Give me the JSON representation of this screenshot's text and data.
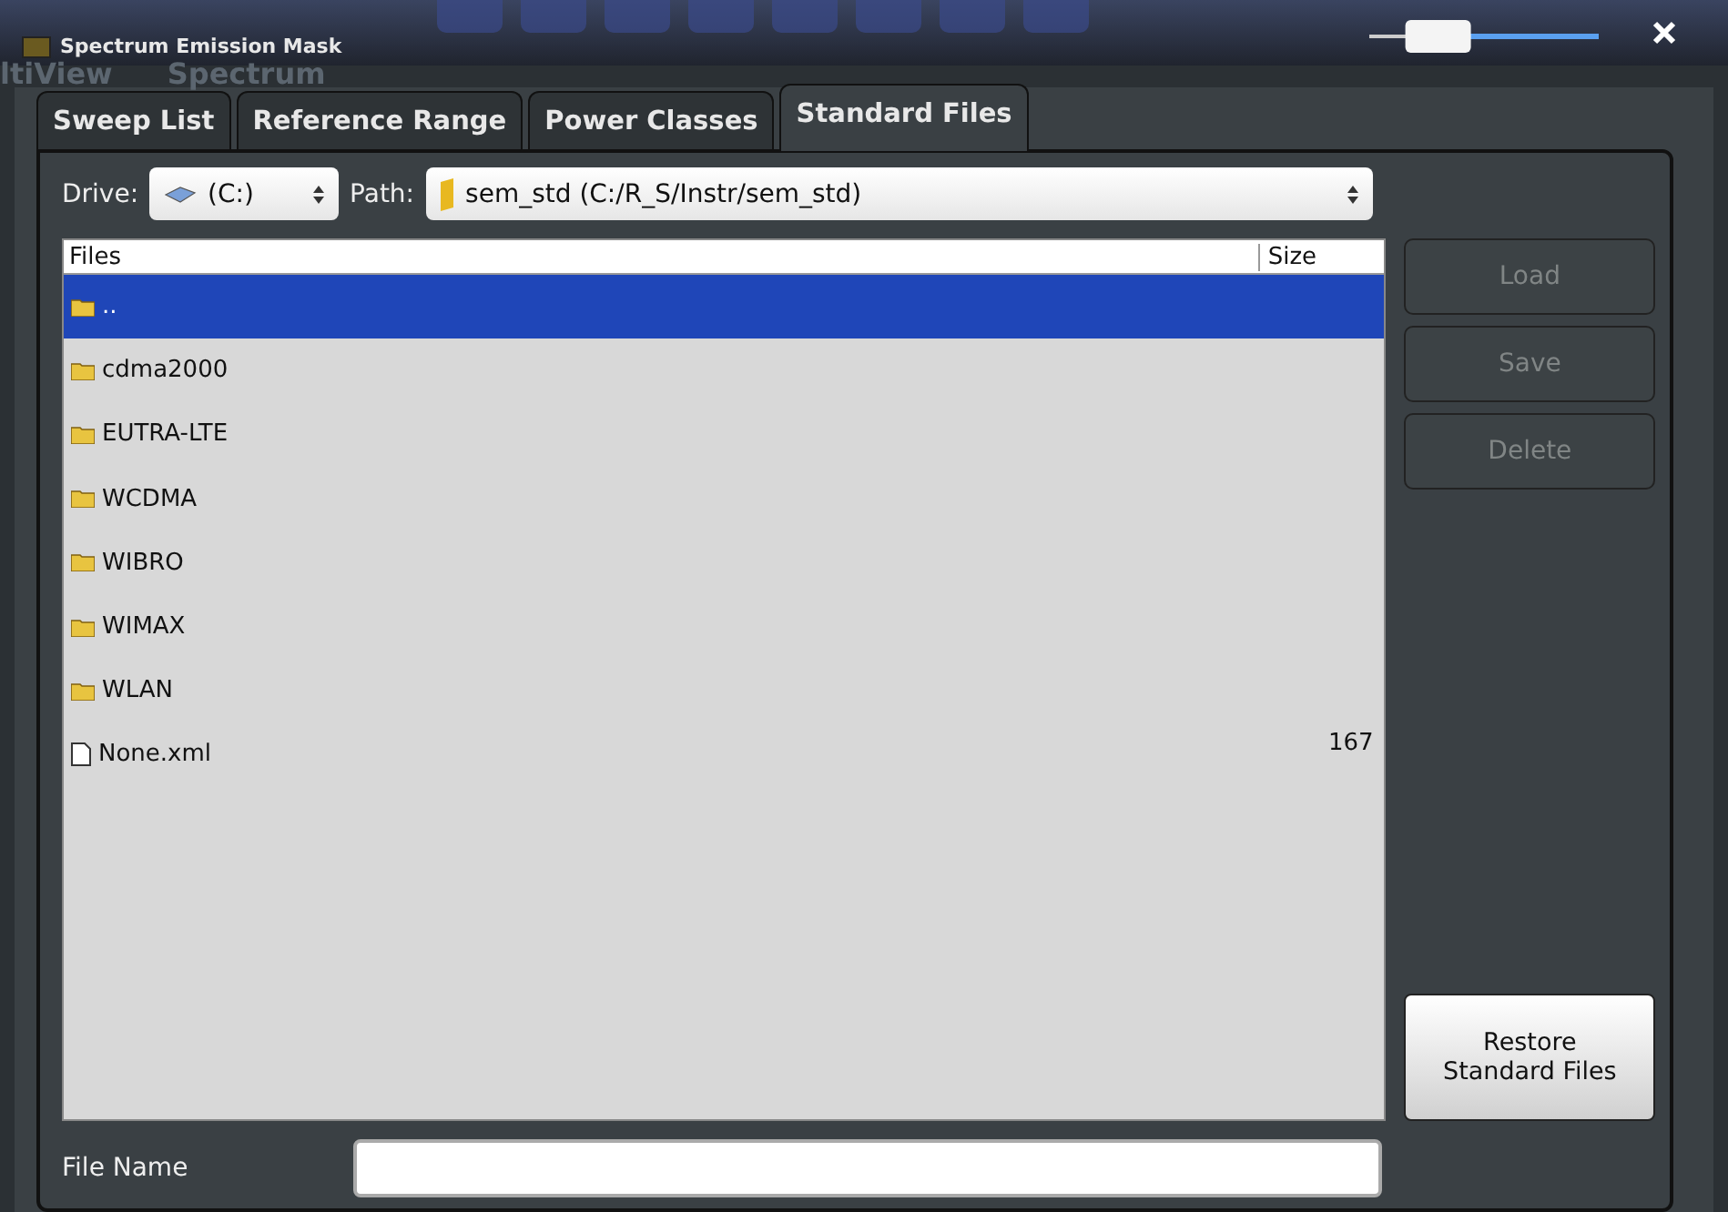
{
  "window": {
    "title": "Spectrum Emission Mask"
  },
  "background_tabs": [
    "ltiView",
    "Spectrum"
  ],
  "transparency": {
    "level": 0.3
  },
  "tabs": [
    {
      "label": "Sweep List",
      "selected": false
    },
    {
      "label": "Reference Range",
      "selected": false
    },
    {
      "label": "Power Classes",
      "selected": false
    },
    {
      "label": "Standard Files",
      "selected": true
    }
  ],
  "drive": {
    "label": "Drive:",
    "value": "(C:)"
  },
  "path": {
    "label": "Path:",
    "value": "sem_std (C:/R_S/Instr/sem_std)"
  },
  "files": {
    "columns": [
      "Files",
      "Size"
    ],
    "rows": [
      {
        "kind": "folder",
        "name": "..",
        "selected": true
      },
      {
        "kind": "folder",
        "name": "cdma2000",
        "selected": false
      },
      {
        "kind": "folder",
        "name": "EUTRA-LTE",
        "selected": false
      },
      {
        "kind": "folder",
        "name": "WCDMA",
        "selected": false
      },
      {
        "kind": "folder",
        "name": "WIBRO",
        "selected": false
      },
      {
        "kind": "folder",
        "name": "WIMAX",
        "selected": false
      },
      {
        "kind": "folder",
        "name": "WLAN",
        "selected": false
      },
      {
        "kind": "file",
        "name": "None.xml",
        "size": "167",
        "selected": false
      }
    ]
  },
  "buttons": [
    {
      "label": "Load",
      "disabled": true
    },
    {
      "label": "Save",
      "disabled": true
    },
    {
      "label": "Delete",
      "disabled": true
    }
  ],
  "restore_button": "Restore Standard Files",
  "file_name": {
    "label": "File Name"
  }
}
